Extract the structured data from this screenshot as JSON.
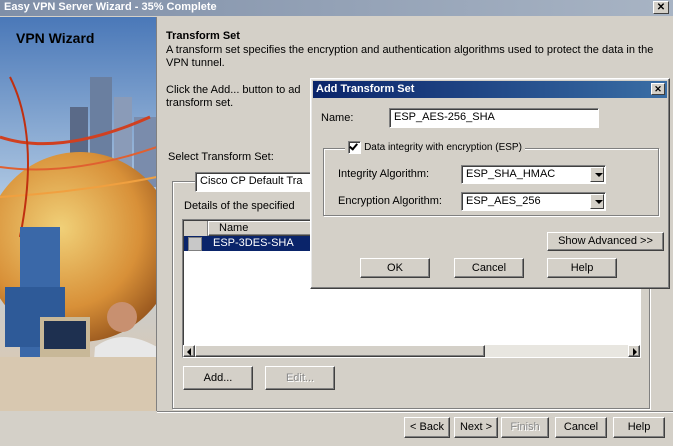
{
  "window": {
    "title": "Easy VPN Server Wizard - 35% Complete",
    "close_glyph": "✕"
  },
  "sidebar": {
    "title": "VPN Wizard"
  },
  "main": {
    "heading": "Transform Set",
    "description": "A transform set specifies the encryption and authentication algorithms used to protect the data in the VPN tunnel.",
    "click_add_line1": "Click the Add... button to ad",
    "click_add_line2": "transform set.",
    "select_label": "Select Transform Set:",
    "select_value": "Cisco CP Default Tra",
    "details_label": "Details of the specified",
    "table": {
      "column_name": "Name",
      "rows": [
        {
          "name": "ESP-3DES-SHA"
        }
      ]
    },
    "add_button": "Add...",
    "edit_button": "Edit..."
  },
  "footer": {
    "back": "< Back",
    "next": "Next >",
    "finish": "Finish",
    "cancel": "Cancel",
    "help": "Help"
  },
  "dialog": {
    "title": "Add Transform Set",
    "name_label": "Name:",
    "name_value": "ESP_AES-256_SHA",
    "integrity_checkbox_label": "Data integrity with encryption (ESP)",
    "integrity_checked": true,
    "integrity_algorithm_label": "Integrity Algorithm:",
    "integrity_algorithm_value": "ESP_SHA_HMAC",
    "encryption_algorithm_label": "Encryption Algorithm:",
    "encryption_algorithm_value": "ESP_AES_256",
    "show_advanced": "Show Advanced >>",
    "ok": "OK",
    "cancel": "Cancel",
    "help": "Help"
  }
}
